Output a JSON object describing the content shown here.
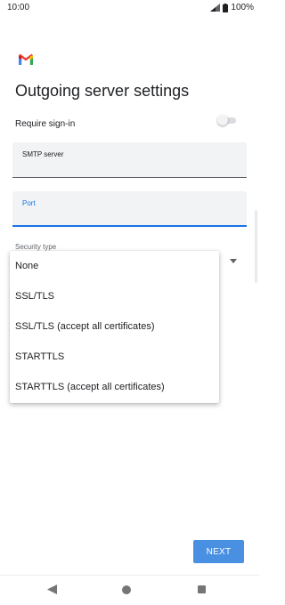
{
  "status_bar": {
    "time": "10:00",
    "battery": "100%"
  },
  "page": {
    "title": "Outgoing server settings"
  },
  "require_signin": {
    "label": "Require sign-in",
    "enabled": false
  },
  "smtp_server": {
    "label": "SMTP server",
    "value": ""
  },
  "port": {
    "label": "Port",
    "value": ""
  },
  "security_type": {
    "label": "Security type",
    "options": [
      "None",
      "SSL/TLS",
      "SSL/TLS (accept all certificates)",
      "STARTTLS",
      "STARTTLS (accept all certificates)"
    ]
  },
  "buttons": {
    "next": "NEXT"
  },
  "icons": {
    "app_logo": "gmail-logo",
    "signal": "signal-icon",
    "battery": "battery-icon",
    "nav_back": "back-icon",
    "nav_home": "home-icon",
    "nav_recents": "recents-icon"
  },
  "colors": {
    "accent": "#1a73e8",
    "next_button": "#4a90e2",
    "field_bg": "#f1f3f4"
  }
}
